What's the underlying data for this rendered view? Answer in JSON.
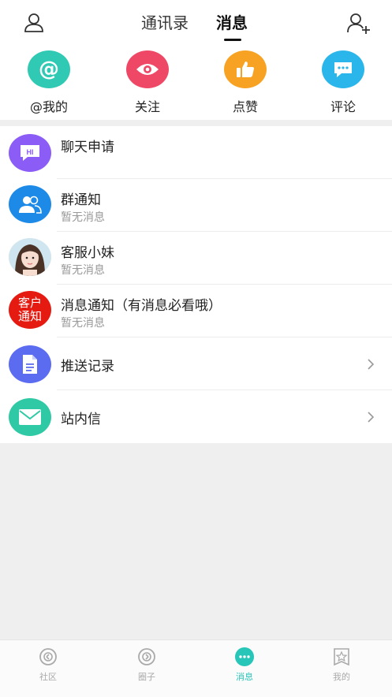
{
  "header": {
    "tab_contacts": "通讯录",
    "tab_messages": "消息",
    "left_icon": "user-icon",
    "right_icon": "add-user-icon"
  },
  "quick_actions": [
    {
      "label": "@我的",
      "icon": "at-icon",
      "color": "#2fc9b4",
      "glyph": "@"
    },
    {
      "label": "关注",
      "icon": "eye-icon",
      "color": "#ef4867"
    },
    {
      "label": "点赞",
      "icon": "thumbs-up-icon",
      "color": "#f7a222"
    },
    {
      "label": "评论",
      "icon": "comment-icon",
      "color": "#2ab6ea"
    }
  ],
  "messages": [
    {
      "title": "聊天申请",
      "subtitle": "",
      "icon": "hi-chat-icon",
      "color": "#8b5cf6",
      "glyph": "HI"
    },
    {
      "title": "群通知",
      "subtitle": "暂无消息",
      "icon": "group-icon",
      "color": "#1d8ae8"
    },
    {
      "title": "客服小妹",
      "subtitle": "暂无消息",
      "icon": "customer-service-avatar"
    },
    {
      "title": "消息通知（有消息必看哦）",
      "subtitle": "暂无消息",
      "icon": "customer-notice-icon",
      "color": "#e51b12",
      "glyph_line1": "客户",
      "glyph_line2": "通知"
    },
    {
      "title": "推送记录",
      "icon": "document-icon",
      "color": "#5b6cf0"
    },
    {
      "title": "站内信",
      "icon": "mail-icon",
      "color": "#2fc9a6"
    }
  ],
  "bottom_nav": [
    {
      "label": "社区",
      "icon": "community-icon",
      "active": false
    },
    {
      "label": "圈子",
      "icon": "circle-icon",
      "active": false
    },
    {
      "label": "消息",
      "icon": "message-icon",
      "active": true
    },
    {
      "label": "我的",
      "icon": "profile-star-icon",
      "active": false
    }
  ],
  "colors": {
    "accent": "#27c6b8",
    "inactive": "#aaaaaa"
  }
}
